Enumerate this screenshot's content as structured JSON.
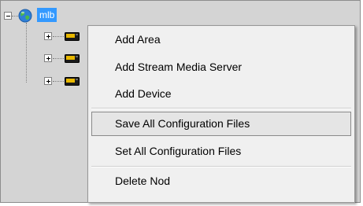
{
  "tree": {
    "root": {
      "label": "mlb",
      "icon": "globe-icon",
      "expanded": true
    },
    "children": [
      {
        "icon": "device-icon",
        "expanded": false
      },
      {
        "icon": "device-icon",
        "expanded": false
      },
      {
        "icon": "device-icon",
        "expanded": false
      }
    ]
  },
  "context_menu": {
    "items": [
      {
        "label": "Add Area"
      },
      {
        "label": "Add Stream Media Server"
      },
      {
        "label": "Add Device"
      },
      {
        "label": "Save All Configuration Files",
        "highlighted": true
      },
      {
        "label": "Set All Configuration Files"
      },
      {
        "label": "Delete Nod"
      }
    ]
  },
  "colors": {
    "panel_bg": "#d4d4d4",
    "selection": "#3399ff",
    "menu_bg": "#f0f0f0",
    "device_icon_yellow": "#e8b800"
  }
}
